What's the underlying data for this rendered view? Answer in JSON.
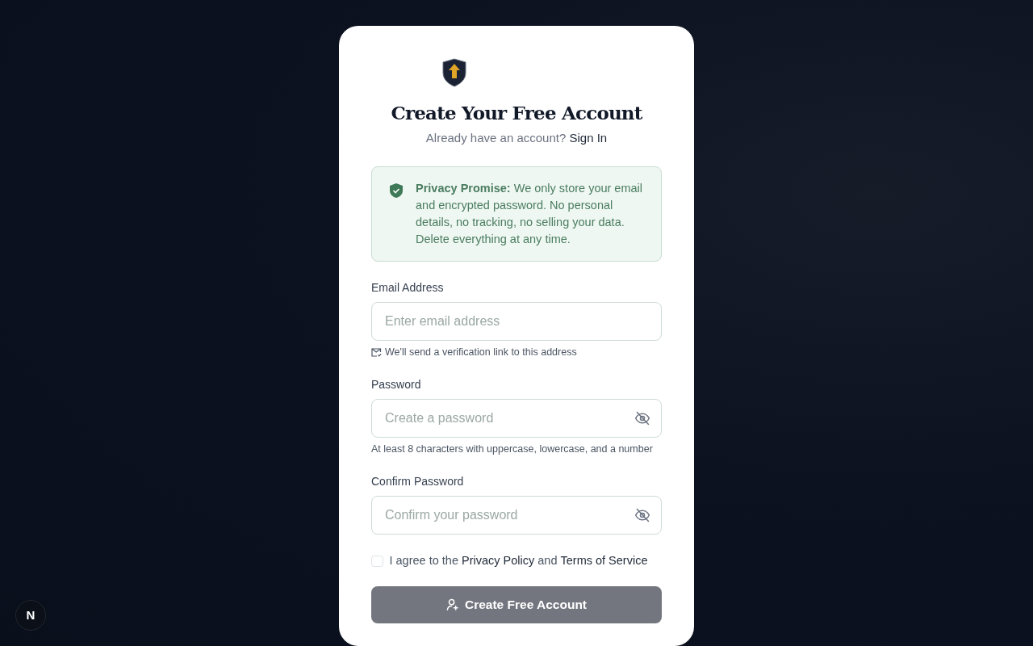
{
  "header": {
    "title": "Create Your Free Account",
    "subtitle": "Already have an account?",
    "sign_in_link": "Sign In"
  },
  "privacy_notice": {
    "text": "**Privacy Promise:** We only store your email and encrypted password. No personal details, no tracking, no selling your data. Delete everything at any time."
  },
  "fields": [
    {
      "kind": "email",
      "label": "Email Address",
      "placeholder": "Enter email address",
      "hint": "We'll send a verification link to this address"
    },
    {
      "kind": "password",
      "label": "Password",
      "placeholder": "Create a password",
      "hint": "At least 8 characters with uppercase, lowercase, and a number"
    },
    {
      "kind": "password",
      "label": "Confirm Password",
      "placeholder": "Confirm your password"
    }
  ],
  "agreement": {
    "checked": false,
    "parts": [
      {
        "kind": "text",
        "text": "I agree to the"
      },
      {
        "kind": "link",
        "text": "Privacy Policy"
      },
      {
        "kind": "text",
        "text": "and"
      },
      {
        "kind": "link",
        "text": "Terms of Service"
      }
    ]
  },
  "submit_button": {
    "label": "Create Free Account",
    "disabled": true
  },
  "dev_badge": {
    "label": "N"
  }
}
